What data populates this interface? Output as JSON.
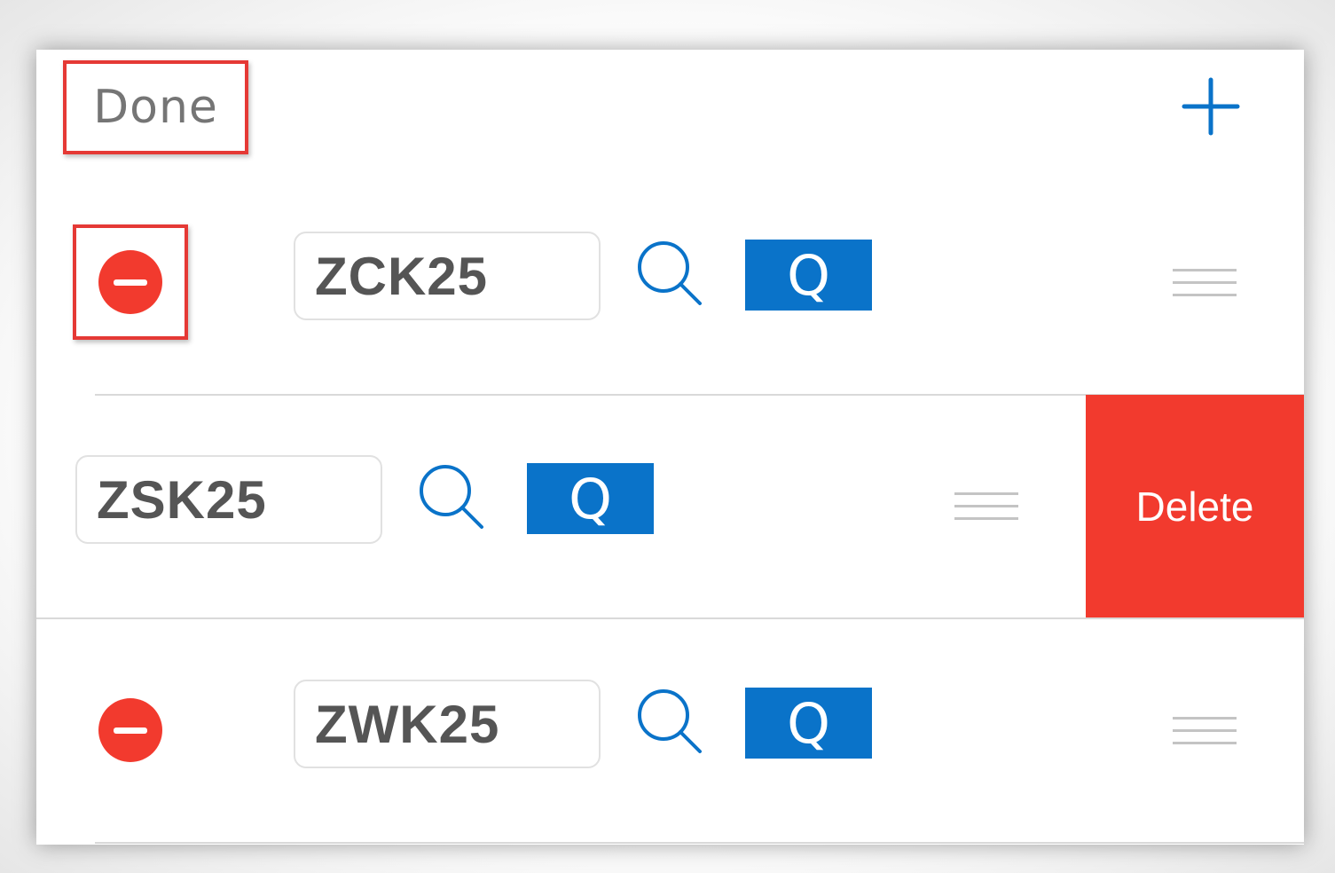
{
  "header": {
    "done_label": "Done",
    "add_icon": "plus-icon"
  },
  "rows": [
    {
      "symbol": "ZCK25",
      "quote_label": "Q",
      "remove_icon": "minus-circle-icon",
      "search_icon": "search-icon",
      "drag_icon": "drag-handle-icon",
      "swiped": false
    },
    {
      "symbol": "ZSK25",
      "quote_label": "Q",
      "search_icon": "search-icon",
      "drag_icon": "drag-handle-icon",
      "swiped": true,
      "delete_label": "Delete"
    },
    {
      "symbol": "ZWK25",
      "quote_label": "Q",
      "remove_icon": "minus-circle-icon",
      "search_icon": "search-icon",
      "drag_icon": "drag-handle-icon",
      "swiped": false
    }
  ],
  "colors": {
    "accent_blue": "#0a73c9",
    "destructive_red": "#f23a2e",
    "highlight_red": "#e53935",
    "text_gray": "#555555"
  }
}
